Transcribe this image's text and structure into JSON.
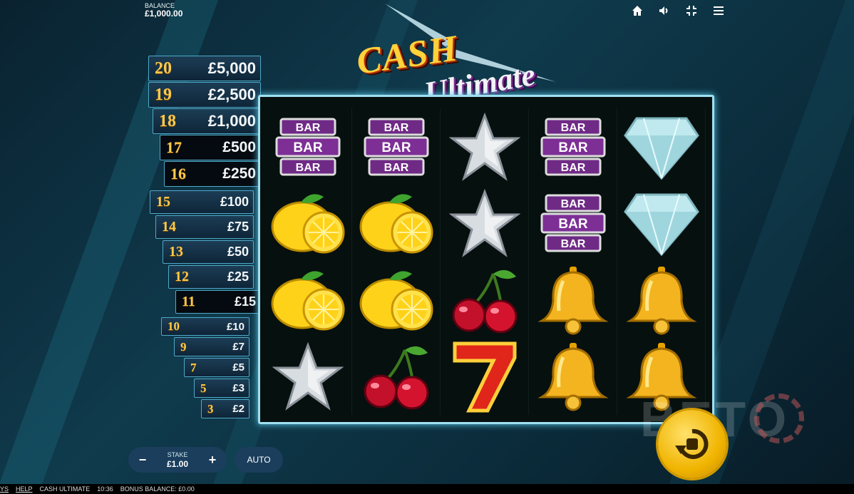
{
  "balance": {
    "label": "BALANCE",
    "value": "£1,000.00"
  },
  "top_icons": [
    "home-icon",
    "volume-icon",
    "fullscreen-icon",
    "menu-icon"
  ],
  "game_logo": {
    "line1": "CASH",
    "line2": "Ultimate"
  },
  "ladder": [
    {
      "level": "20",
      "prize": "£5,000"
    },
    {
      "level": "19",
      "prize": "£2,500"
    },
    {
      "level": "18",
      "prize": "£1,000"
    },
    {
      "level": "17",
      "prize": "£500"
    },
    {
      "level": "16",
      "prize": "£250"
    },
    {
      "level": "15",
      "prize": "£100"
    },
    {
      "level": "14",
      "prize": "£75"
    },
    {
      "level": "13",
      "prize": "£50"
    },
    {
      "level": "12",
      "prize": "£25"
    },
    {
      "level": "11",
      "prize": "£15"
    },
    {
      "level": "10",
      "prize": "£10"
    },
    {
      "level": "9",
      "prize": "£7"
    },
    {
      "level": "7",
      "prize": "£5"
    },
    {
      "level": "5",
      "prize": "£3"
    },
    {
      "level": "3",
      "prize": "£2"
    }
  ],
  "reels": [
    [
      "bar",
      "bar",
      "star",
      "bar",
      "diamond"
    ],
    [
      "lemon",
      "lemon",
      "star",
      "bar",
      "diamond"
    ],
    [
      "lemon",
      "lemon",
      "cherry",
      "bell",
      "bell"
    ],
    [
      "star",
      "cherry",
      "seven",
      "bell",
      "bell"
    ]
  ],
  "bar_symbol_text": "BAR",
  "seven_symbol_text": "7",
  "stake": {
    "label": "STAKE",
    "value": "£1.00",
    "minus": "−",
    "plus": "+"
  },
  "auto_label": "AUTO",
  "watermark": "BETO",
  "statusbar": {
    "ways": "YS",
    "help": "HELP",
    "game": "CASH ULTIMATE",
    "time": "10:36",
    "bonus": "BONUS BALANCE: £0.00"
  },
  "colors": {
    "ladder_level": "#ffc94a",
    "frame": "#9fdff0",
    "spin": "#f0b400",
    "panel": "#1a3e5c"
  }
}
